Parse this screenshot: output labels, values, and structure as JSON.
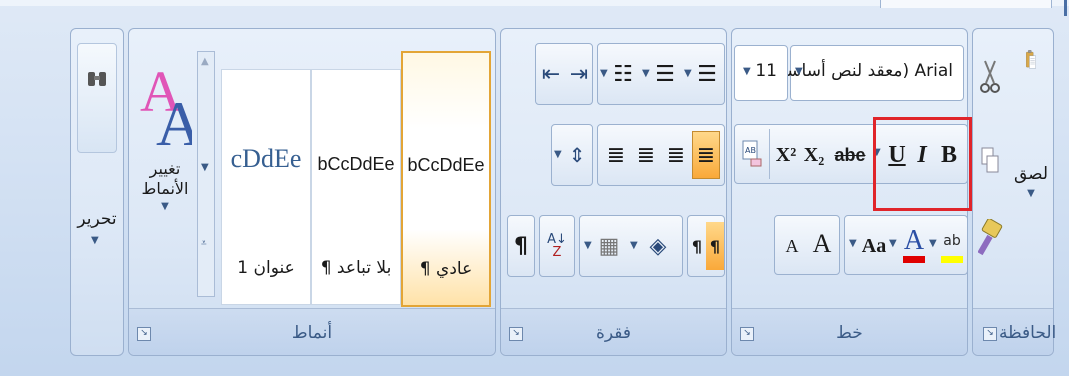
{
  "groups": {
    "clipboard": {
      "label": "الحافظة",
      "paste_label": "لصق"
    },
    "font": {
      "label": "خط",
      "font_name": "معقد لنص أساسي) Arial",
      "font_size": "11"
    },
    "paragraph": {
      "label": "فقرة"
    },
    "styles": {
      "label": "أنماط",
      "change_styles_label": "تغيير الأنماط",
      "tiles": [
        {
          "sample": "bCcDdEe",
          "name": "¶ عادي"
        },
        {
          "sample": "bCcDdEe",
          "name": "¶ بلا تباعد"
        },
        {
          "sample": "cDdEe",
          "name": "عنوان 1"
        }
      ]
    },
    "editing": {
      "label": "تحرير"
    }
  },
  "font_buttons": {
    "bold": "B",
    "italic": "I",
    "underline": "U",
    "strike": "abe",
    "subscript": "X₂",
    "superscript": "X²",
    "grow": "A",
    "shrink": "A",
    "case": "Aa",
    "font_color": "A",
    "highlight": "ab"
  },
  "colors": {
    "highlight_annotation": "#e0242a",
    "font_color_bar": "#e00000",
    "highlight_bar": "#ffff00",
    "selected_tile": "#ffc65a"
  }
}
